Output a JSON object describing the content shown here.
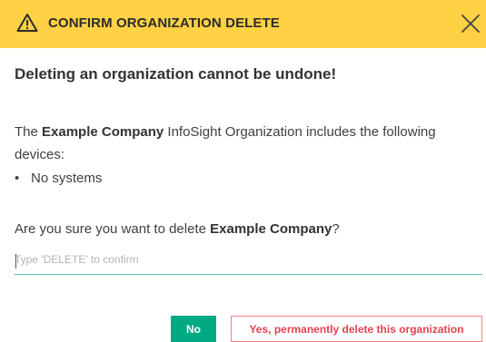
{
  "dialog": {
    "title": "CONFIRM ORGANIZATION DELETE",
    "header_color": "#ffd144",
    "warning_icon": "warning-triangle-icon",
    "close_icon": "close-x-icon",
    "heading": "Deleting an organization cannot be undone!"
  },
  "body": {
    "intro_prefix": "The ",
    "company_name": "Example Company",
    "intro_suffix": " InfoSight Organization includes the following devices:",
    "devices": [
      "No systems"
    ],
    "question_prefix": "Are you sure you want to delete ",
    "question_suffix": "?"
  },
  "confirm_input": {
    "value": "",
    "placeholder": "Type 'DELETE' to confirm"
  },
  "actions": {
    "no_label": "No",
    "no_color": "#01a982",
    "yes_label": "Yes, permanently delete this organization",
    "yes_color": "#e5414f"
  }
}
